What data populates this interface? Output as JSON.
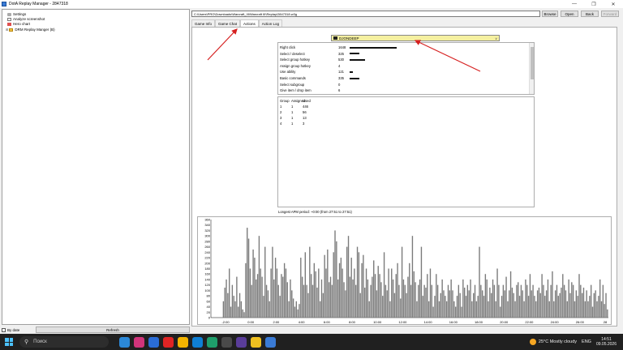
{
  "window": {
    "title": "DotA Replay Manager - 2847318"
  },
  "tree": {
    "items": [
      {
        "label": "Settings",
        "icon": "gear-icon"
      },
      {
        "label": "Analyze screenshot",
        "icon": "document-icon"
      },
      {
        "label": "Hero chart",
        "icon": "chart-icon"
      },
      {
        "label": "DRM Replay Manger (B)",
        "icon": "folder-icon"
      }
    ]
  },
  "left_bottom": {
    "checkbox_label": "By date",
    "refresh_label": "Refresh"
  },
  "toolbar": {
    "path": "C:\\Users\\PRO\\Downloads\\Warcraft_III\\Warcraft III\\Replay\\2847318.w3g",
    "browse": "Browse",
    "open": "Open",
    "back": "Back",
    "forward": "Forward"
  },
  "tabs": [
    "Game Info",
    "Game Chat",
    "Actions",
    "Action Log"
  ],
  "player": {
    "name": "DJONDEEP"
  },
  "actions": [
    {
      "label": "Right click",
      "count": "1648",
      "fraction": 1.0
    },
    {
      "label": "Select / deselect",
      "count": "325",
      "fraction": 0.2
    },
    {
      "label": "Select group hotkey",
      "count": "530",
      "fraction": 0.32
    },
    {
      "label": "Assign group hotkey",
      "count": "4",
      "fraction": 0.0
    },
    {
      "label": "Use ability",
      "count": "121",
      "fraction": 0.07
    },
    {
      "label": "Basic commands",
      "count": "335",
      "fraction": 0.2
    },
    {
      "label": "Select subgroup",
      "count": "0",
      "fraction": 0.0
    },
    {
      "label": "Give item / drop item",
      "count": "6",
      "fraction": 0.0
    }
  ],
  "groups": {
    "headers": [
      "Group",
      "Assigned",
      "Used"
    ],
    "rows": [
      [
        "1",
        "1",
        "446"
      ],
      [
        "2",
        "1",
        "56"
      ],
      [
        "3",
        "1",
        "13"
      ],
      [
        "4",
        "1",
        "3"
      ]
    ]
  },
  "apm_text": "Longest APM period: ~0:00 (from 27:51 to 27:51)",
  "chart_data": {
    "type": "bar",
    "y_ticks": [
      "360",
      "340",
      "320",
      "300",
      "280",
      "260",
      "240",
      "220",
      "200",
      "180",
      "160",
      "140",
      "120",
      "100",
      "80",
      "60",
      "40",
      "20",
      "0"
    ],
    "x_ticks": [
      "-2:00",
      "0:00",
      "2:00",
      "4:00",
      "6:00",
      "8:00",
      "10:00",
      "12:00",
      "14:00",
      "16:00",
      "18:00",
      "20:00",
      "22:00",
      "24:00",
      "26:00",
      "28"
    ],
    "ylim": [
      0,
      360
    ],
    "values": [
      0,
      0,
      0,
      0,
      0,
      0,
      0,
      0,
      60,
      110,
      140,
      90,
      180,
      40,
      120,
      80,
      60,
      150,
      40,
      90,
      60,
      30,
      20,
      200,
      330,
      290,
      180,
      120,
      250,
      220,
      140,
      160,
      300,
      180,
      150,
      80,
      260,
      120,
      100,
      60,
      180,
      260,
      140,
      220,
      180,
      120,
      80,
      160,
      150,
      200,
      180,
      130,
      60,
      140,
      100,
      70,
      40,
      60,
      30,
      50,
      220,
      150,
      120,
      240,
      120,
      90,
      260,
      160,
      120,
      200,
      170,
      110,
      180,
      60,
      140,
      90,
      230,
      180,
      250,
      130,
      150,
      120,
      240,
      320,
      280,
      140,
      200,
      220,
      180,
      130,
      100,
      260,
      300,
      150,
      220,
      140,
      180,
      120,
      260,
      240,
      90,
      200,
      230,
      110,
      180,
      140,
      60,
      120,
      150,
      210,
      160,
      100,
      190,
      160,
      130,
      80,
      240,
      120,
      100,
      180,
      60,
      180,
      140,
      90,
      160,
      200,
      120,
      70,
      260,
      140,
      120,
      90,
      150,
      200,
      120,
      300,
      170,
      130,
      60,
      120,
      140,
      260,
      80,
      120,
      110,
      160,
      60,
      180,
      120,
      40,
      80,
      160,
      120,
      60,
      90,
      140,
      100,
      80,
      60,
      120,
      100,
      140,
      100,
      60,
      40,
      80,
      120,
      90,
      40,
      140,
      110,
      80,
      120,
      100,
      140,
      60,
      90,
      120,
      60,
      80,
      260,
      120,
      100,
      80,
      160,
      140,
      60,
      110,
      90,
      140,
      120,
      60,
      180,
      120,
      40,
      80,
      120,
      100,
      150,
      60,
      100,
      170,
      110,
      90,
      60,
      120,
      130,
      80,
      120,
      100,
      60,
      140,
      120,
      80,
      160,
      100,
      120,
      80,
      60,
      100,
      110,
      90,
      160,
      120,
      80,
      100,
      140,
      60,
      120,
      170,
      60,
      100,
      120,
      80,
      90,
      110,
      160,
      120,
      100,
      60,
      140,
      90,
      130,
      120,
      60,
      100,
      80,
      160,
      120,
      90,
      110,
      60,
      100,
      60,
      80,
      120,
      40,
      90,
      100,
      60,
      80,
      140,
      60,
      120,
      50,
      90,
      30
    ]
  },
  "taskbar": {
    "search_placeholder": "Поиск",
    "weather": "25°C  Mostly cloudy",
    "lang": "ENG",
    "time": "14:51",
    "date": "09.05.2026"
  }
}
